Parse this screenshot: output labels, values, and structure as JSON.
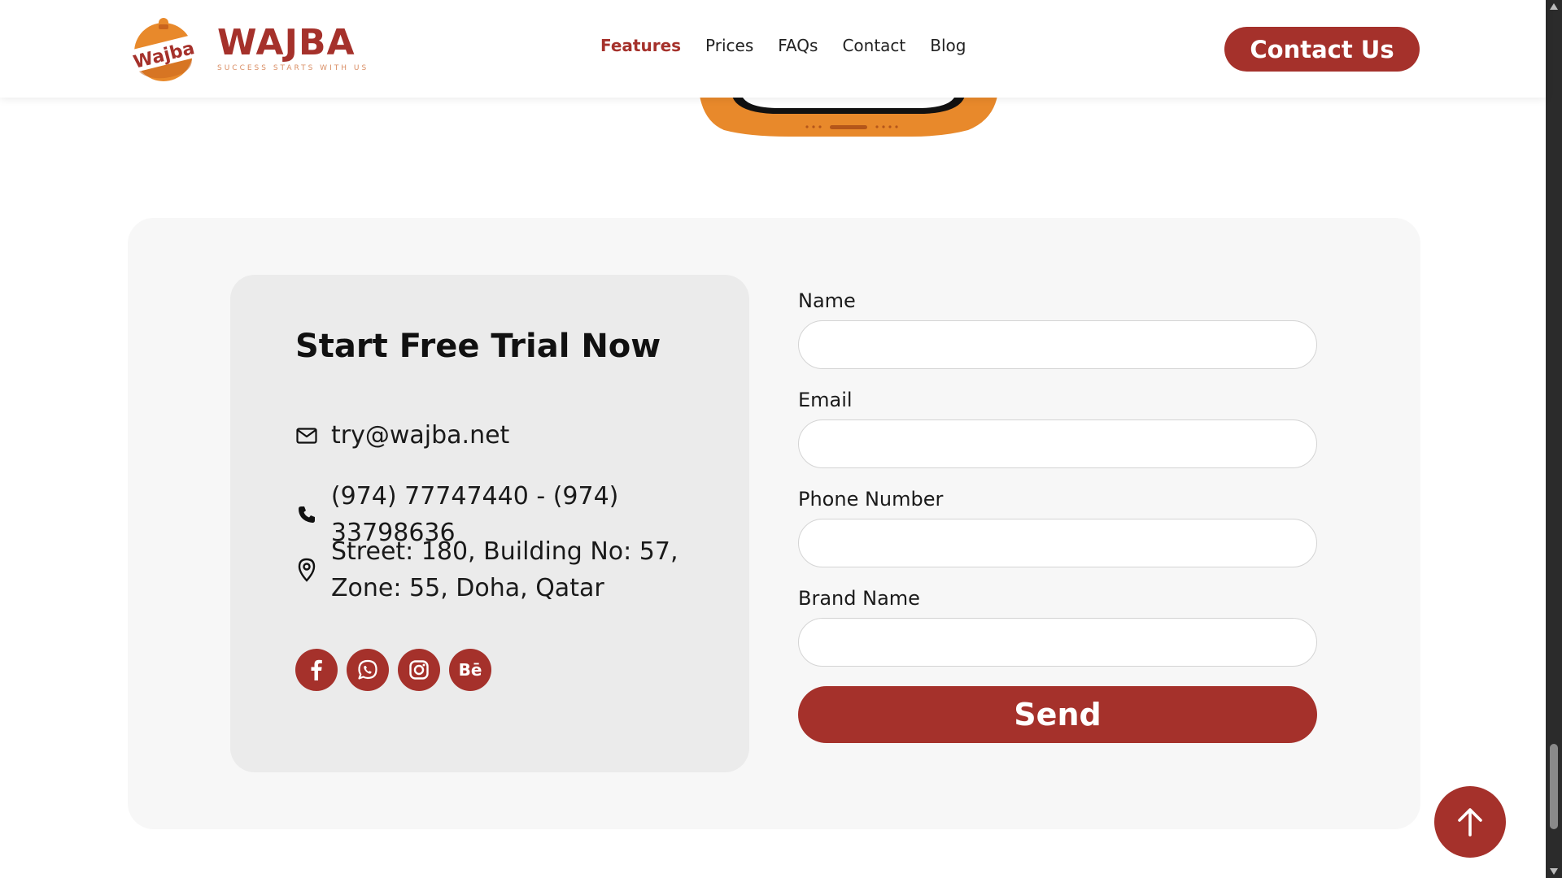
{
  "brand": {
    "name": "WAJBA",
    "badge_text": "Wajba",
    "tagline": "SUCCESS STARTS WITH US",
    "primary_color": "#a5312b",
    "accent_color": "#e8892b"
  },
  "nav": {
    "items": [
      {
        "label": "Features",
        "active": true
      },
      {
        "label": "Prices",
        "active": false
      },
      {
        "label": "FAQs",
        "active": false
      },
      {
        "label": "Contact",
        "active": false
      },
      {
        "label": "Blog",
        "active": false
      }
    ],
    "cta_label": "Contact Us"
  },
  "info": {
    "title": "Start Free Trial Now",
    "email": "try@wajba.net",
    "phone": "(974) 77747440 - (974) 33798636",
    "address_line1": "Street: 180, Building No: 57,",
    "address_line2": "Zone: 55, Doha, Qatar",
    "socials": [
      {
        "name": "facebook-icon",
        "glyph": "f"
      },
      {
        "name": "whatsapp-icon",
        "glyph": ""
      },
      {
        "name": "instagram-icon",
        "glyph": ""
      },
      {
        "name": "behance-icon",
        "glyph": "Bē"
      }
    ]
  },
  "form": {
    "name_label": "Name",
    "email_label": "Email",
    "phone_label": "Phone Number",
    "brand_label": "Brand Name",
    "submit_label": "Send"
  }
}
